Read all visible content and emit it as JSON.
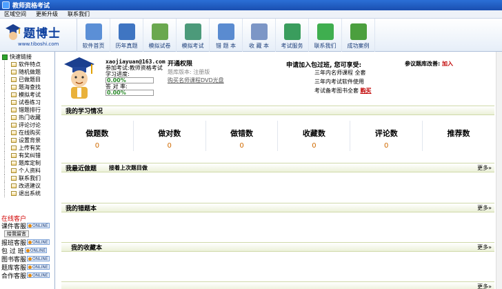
{
  "window": {
    "title": "教师资格考试"
  },
  "menu": [
    "区域空间",
    "更新升级",
    "联系我们"
  ],
  "logo": {
    "brand": "题博士",
    "url": "www.tiboshi.com"
  },
  "toolbar": [
    {
      "label": "软件首页",
      "icon": "home-icon",
      "color": "#5b8fd6"
    },
    {
      "label": "历年真题",
      "icon": "exam-icon",
      "color": "#3f75c2"
    },
    {
      "label": "模拟试卷",
      "icon": "paper-icon",
      "color": "#6aa84f"
    },
    {
      "label": "模拟考试",
      "icon": "test-icon",
      "color": "#4c9a7a"
    },
    {
      "label": "错 题 本",
      "icon": "wrong-book-icon",
      "color": "#5a8bd0"
    },
    {
      "label": "收 藏 本",
      "icon": "favorite-icon",
      "color": "#7c96c6"
    },
    {
      "label": "考试服务",
      "icon": "service-icon",
      "color": "#3a9d5d"
    },
    {
      "label": "联系我们",
      "icon": "contact-icon",
      "color": "#3fae4f"
    },
    {
      "label": "成功案例",
      "icon": "case-icon",
      "color": "#4b9f3e"
    }
  ],
  "sidebar": {
    "root": "快速链接",
    "items": [
      "软件特点",
      "随机做题",
      "已做题目",
      "题海查找",
      "模拟考试",
      "试卷练习",
      "错题排行",
      "热门收藏",
      "评论讨论",
      "在线购买",
      "设置背景",
      "上传有奖",
      "有奖纠错",
      "题库定制",
      "个人资料",
      "联系我们",
      "改进建议",
      "退出系统"
    ],
    "online_title": "在线客户",
    "online": [
      {
        "label": "课件客服",
        "badge": "ONLINE"
      },
      {
        "label": "报班客服",
        "badge": "ONLINE"
      },
      {
        "label": "包 过 班",
        "badge": "ONLINE"
      },
      {
        "label": "图书客服",
        "badge": "ONLINE"
      },
      {
        "label": "题库客服",
        "badge": "ONLINE"
      },
      {
        "label": "合作客服",
        "badge": "ONLINE"
      }
    ],
    "message_btn": "给我留言"
  },
  "user": {
    "email": "xaojiayuan@163.com",
    "exam": "参加考试:教师资格考试",
    "progress_label": "学习进度:",
    "progress": "0.00%",
    "accuracy_label": "答 对 率:",
    "accuracy": "0.00%"
  },
  "permission": {
    "title": "开通权限",
    "version": "题库版本: 注册版",
    "buy": "购买名师课程DVD光盘"
  },
  "join": {
    "title": "申请加入包过班, 您可享受:",
    "items": [
      "三年内名师课程 全套",
      "三年内考试软件使用",
      "考试备考图书全套"
    ],
    "buy": "购买"
  },
  "ref": {
    "text": "参议题库改善:",
    "link": "加入"
  },
  "sections": {
    "study": "我的学习情况",
    "recent": "我最近做题",
    "recent_sub": "接着上次题目做",
    "wrong": "我的错题本",
    "fav": "我的收藏本",
    "more": "更多»"
  },
  "stats": [
    {
      "label": "做题数",
      "value": "0"
    },
    {
      "label": "做对数",
      "value": "0"
    },
    {
      "label": "做错数",
      "value": "0"
    },
    {
      "label": "收藏数",
      "value": "0"
    },
    {
      "label": "评论数",
      "value": "0"
    },
    {
      "label": "推荐数",
      "value": ""
    }
  ]
}
